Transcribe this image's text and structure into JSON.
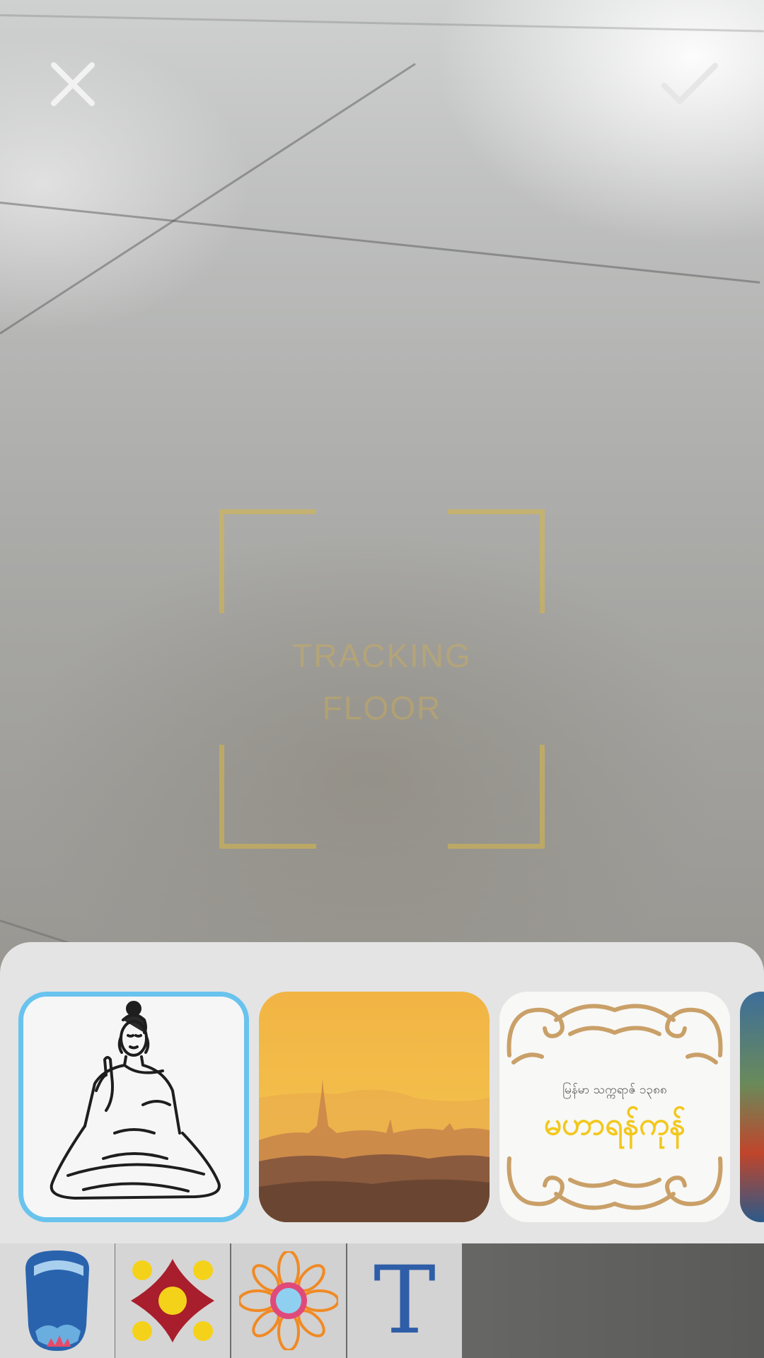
{
  "toolbar": {
    "close_icon": "close-icon",
    "confirm_icon": "checkmark-icon"
  },
  "tracking": {
    "label": "TRACKING\nFLOOR"
  },
  "tray": {
    "selected_index": 0,
    "items": [
      {
        "name": "buddha-sticker"
      },
      {
        "name": "temple-sunset-scene"
      },
      {
        "name": "title-card",
        "small_text": "မြန်မာ သက္ကရာဇ် ၁၃၈၈",
        "big_text": "မဟာရန်ကုန်"
      },
      {
        "name": "painting-scene"
      }
    ]
  },
  "categories": [
    {
      "name": "lantern-category",
      "icon": "lantern-icon"
    },
    {
      "name": "flower-category",
      "icon": "flower-icon"
    },
    {
      "name": "mandala-category",
      "icon": "mandala-icon"
    },
    {
      "name": "text-category",
      "icon": "text-icon",
      "label": "T"
    }
  ],
  "colors": {
    "selection": "#69c3ee",
    "tracking": "#d8b846",
    "text_tool": "#2f5ea8"
  }
}
